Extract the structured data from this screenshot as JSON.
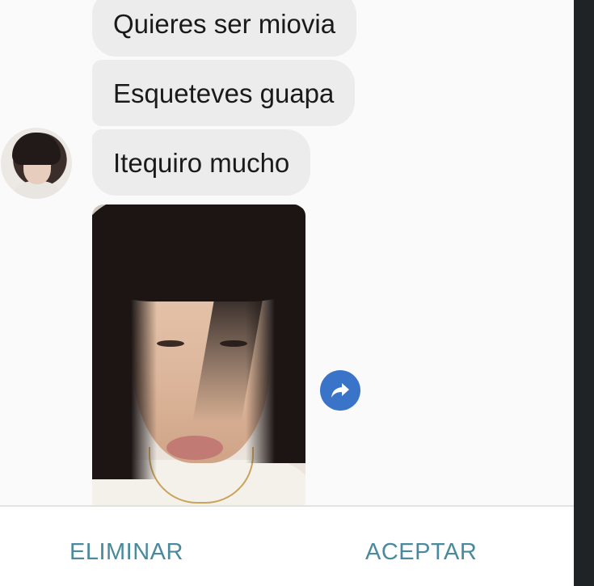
{
  "messages": [
    {
      "text": "Quieres ser miovia"
    },
    {
      "text": "Esqueteves guapa"
    },
    {
      "text": "Itequiro mucho"
    }
  ],
  "icons": {
    "avatar": "avatar-photo",
    "share": "share-arrow-icon"
  },
  "colors": {
    "bubble": "#ececec",
    "share_button": "#3a74c9",
    "footer_button_text": "#4a8a9c"
  },
  "footer": {
    "delete_label": "ELIMINAR",
    "accept_label": "ACEPTAR"
  }
}
